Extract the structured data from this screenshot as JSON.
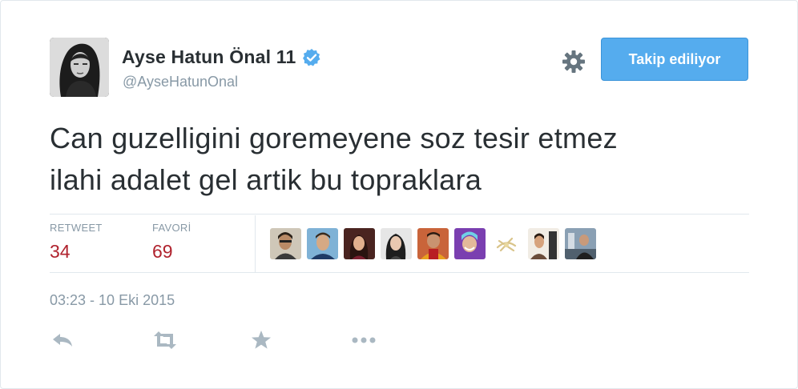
{
  "user": {
    "display_name": "Ayse Hatun Önal 11",
    "handle": "@AyseHatunOnal",
    "verified": true
  },
  "follow_button": {
    "label": "Takip ediliyor"
  },
  "tweet": {
    "text_line1": "Can guzelligini goremeyene soz tesir etmez",
    "text_line2": "ilahi adalet gel artik bu topraklara",
    "timestamp": "03:23 - 10 Eki 2015"
  },
  "stats": {
    "retweet_label": "RETWEET",
    "retweet_count": "34",
    "favorite_label": "FAVORİ",
    "favorite_count": "69"
  },
  "favorited_by_count_shown": 9,
  "actions": [
    "reply-icon",
    "retweet-icon",
    "favorite-icon",
    "more-icon"
  ],
  "colors": {
    "accent_blue": "#55acee",
    "count_red": "#b0232e",
    "muted_gray": "#8899a6",
    "text": "#292f33",
    "action_gray": "#aab8c2"
  }
}
